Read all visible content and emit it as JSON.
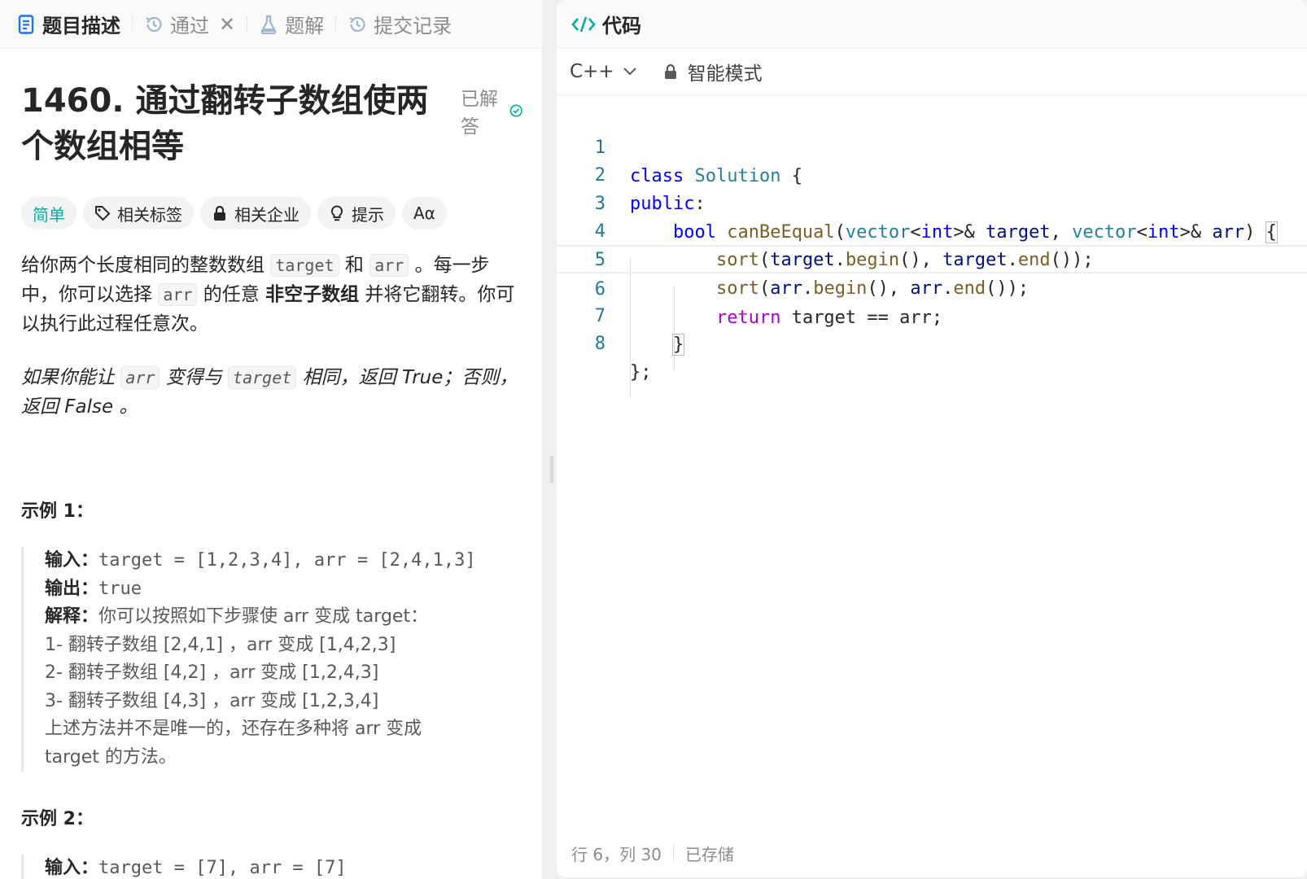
{
  "left_tabs": [
    {
      "label": "题目描述",
      "icon": "document-icon",
      "active": true
    },
    {
      "label": "通过",
      "icon": "history-icon",
      "closable": true
    },
    {
      "label": "题解",
      "icon": "flask-icon"
    },
    {
      "label": "提交记录",
      "icon": "history-icon"
    }
  ],
  "problem": {
    "title": "1460. 通过翻转子数组使两个数组相等",
    "solved_label": "已解答",
    "tags": {
      "difficulty": "简单",
      "related_tags": "相关标签",
      "companies": "相关企业",
      "hint": "提示",
      "font_toggle": "Aα"
    },
    "para1": {
      "t1": "给你两个长度相同的整数数组 ",
      "c1": "target",
      "t2": " 和 ",
      "c2": "arr",
      "t3": " 。每一步中，你可以选择 ",
      "c3": "arr",
      "t4": " 的任意 ",
      "b1": "非空子数组",
      "t5": " 并将它翻转。你可以执行此过程任意次。"
    },
    "para2": {
      "t1": "如果你能让 ",
      "c1": "arr",
      "t2": " 变得与 ",
      "c2": "target",
      "t3": " 相同，返回 True；否则，返回 False 。"
    },
    "example1": {
      "title": "示例 1：",
      "input_label": "输入：",
      "input": "target = [1,2,3,4], arr = [2,4,1,3]",
      "output_label": "输出：",
      "output": "true",
      "explain_label": "解释：",
      "explain_lines": [
        "你可以按照如下步骤使 arr 变成 target：",
        "1- 翻转子数组 [2,4,1] ，arr 变成 [1,4,2,3]",
        "2- 翻转子数组 [4,2] ，arr 变成 [1,2,4,3]",
        "3- 翻转子数组 [4,3] ，arr 变成 [1,2,3,4]",
        "上述方法并不是唯一的，还存在多种将 arr 变成",
        "target 的方法。"
      ]
    },
    "example2": {
      "title": "示例 2：",
      "input_label": "输入：",
      "input": "target = [7], arr = [7]"
    }
  },
  "code_panel": {
    "title": "代码",
    "icon": "code-icon",
    "language": "C++",
    "mode": "智能模式",
    "line_numbers": [
      "1",
      "2",
      "3",
      "4",
      "5",
      "6",
      "7",
      "8"
    ],
    "status": {
      "position": "行 6，列 30",
      "saved": "已存储"
    }
  },
  "colors": {
    "accent_green": "#00af9b",
    "code_keyword": "#0000ff",
    "code_type": "#267f99",
    "code_function": "#795e26",
    "code_variable": "#001080",
    "code_control": "#af00db"
  }
}
